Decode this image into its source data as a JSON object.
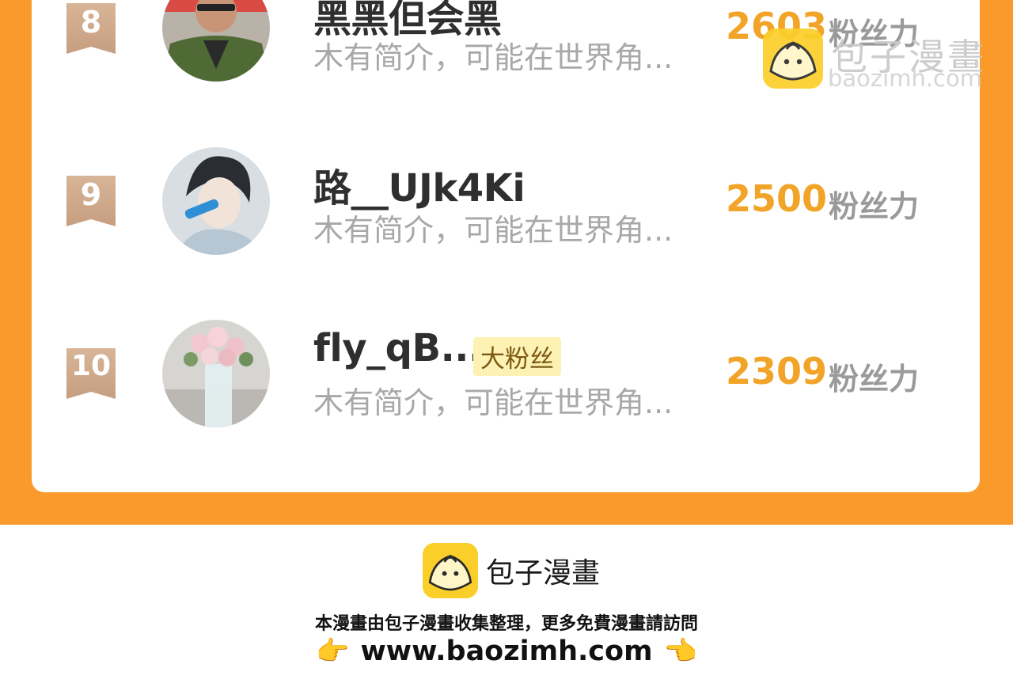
{
  "ranking": [
    {
      "rank": "8",
      "name": "黑黑但会黑",
      "intro": "木有简介，可能在世界角...",
      "score": "2603",
      "unit": "粉丝力",
      "badge": ""
    },
    {
      "rank": "9",
      "name": "路__UJk4Ki",
      "intro": "木有简介，可能在世界角...",
      "score": "2500",
      "unit": "粉丝力",
      "badge": ""
    },
    {
      "rank": "10",
      "name": "fly_qB...",
      "intro": "木有简介，可能在世界角...",
      "score": "2309",
      "unit": "粉丝力",
      "badge": "大粉丝"
    }
  ],
  "watermark": {
    "brand": "包子漫畫",
    "domain": "baozimh.com"
  },
  "footer": {
    "brand": "包子漫畫",
    "note": "本漫畫由包子漫畫收集整理，更多免費漫畫請訪問",
    "url": "www.baozimh.com",
    "left_icon": "pointing-right-hand",
    "right_icon": "pointing-left-hand"
  },
  "colors": {
    "orange": "#fa9a2a",
    "score": "#f2a429",
    "ribbon": "#cfa788",
    "badge_bg": "#fdf1b3"
  }
}
